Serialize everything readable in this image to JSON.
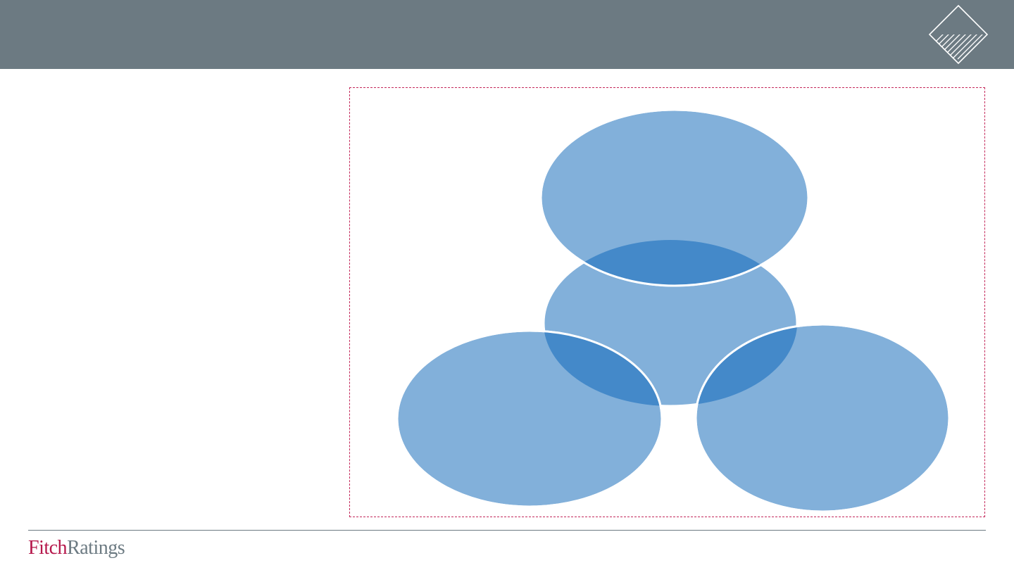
{
  "brand": {
    "part1": "Fitch",
    "part2": "Ratings",
    "color_primary": "#b5174b",
    "color_secondary": "#6c7a82"
  },
  "header": {
    "background": "#6c7a82",
    "logo_icon": "fitch-diamond-hatched-icon"
  },
  "diagram": {
    "type": "venn-4-circles",
    "circle_labels": [
      "",
      "",
      "",
      ""
    ],
    "fill_color": "#82b0da",
    "overlap_color": "#4489c9",
    "outline_color": "#ffffff",
    "frame_border_color": "#c4285a"
  }
}
